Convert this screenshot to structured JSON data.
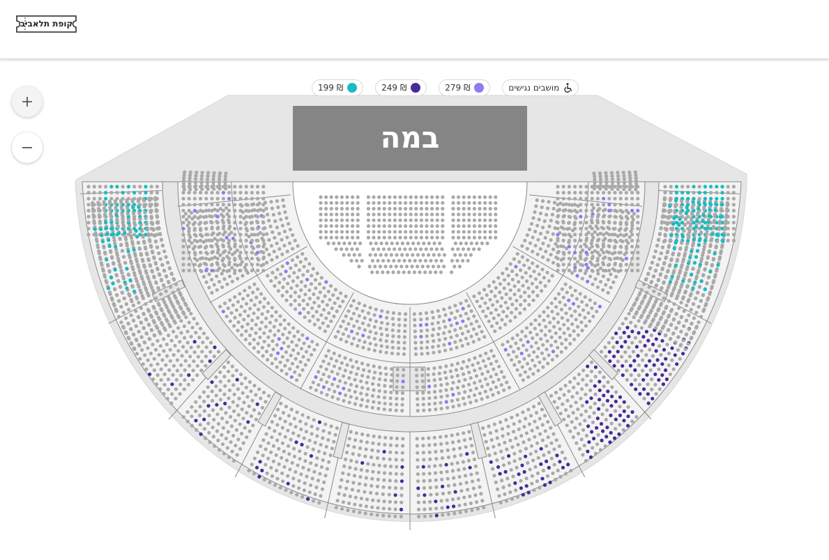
{
  "header": {
    "logo_text": "קופת תלאביב"
  },
  "zoom": {
    "in_symbol": "+",
    "out_symbol": "−"
  },
  "legend": {
    "accessible": {
      "label": "מושבים נגישים",
      "icon": "wheelchair-icon"
    },
    "tiers": [
      {
        "label": "279 ₪",
        "color": "#8b7cf2"
      },
      {
        "label": "249 ₪",
        "color": "#472c99"
      },
      {
        "label": "199 ₪",
        "color": "#18bcc0"
      }
    ]
  },
  "stage": {
    "label": "במה"
  },
  "colors": {
    "seat_default": "#a9a9a9",
    "seat_stroke": "#8a8a8a",
    "hall_fill": "#e6e6e6",
    "section_fill": "#f3f3f3",
    "stage_fill": "#858585"
  }
}
